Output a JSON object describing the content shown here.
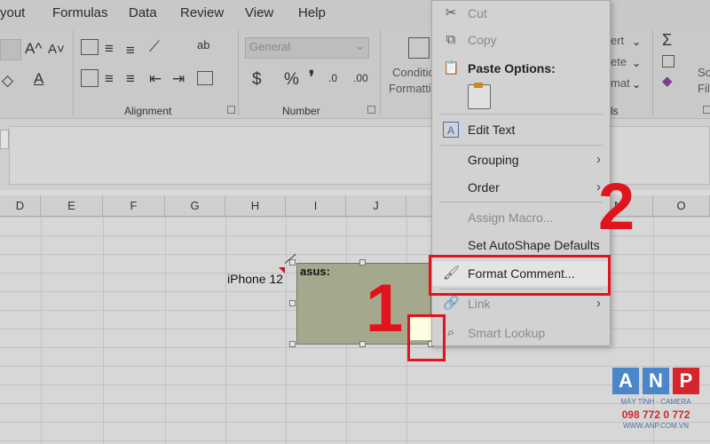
{
  "menubar": {
    "tabs": [
      "yout",
      "Formulas",
      "Data",
      "Review",
      "View",
      "Help"
    ]
  },
  "ribbon": {
    "font_size_glyphs": [
      "A^",
      "A˅"
    ],
    "groups": {
      "alignment": "Alignment",
      "number": "Number"
    },
    "number_format": "General",
    "currency": "$",
    "percent": "%",
    "comma": "❜",
    "conditional": [
      "Conditio",
      "Formatti"
    ],
    "partial_right": [
      "ert",
      "ete",
      "mat"
    ],
    "partial_label": "ls",
    "sigma": "Σ",
    "sort_labels": [
      "So",
      "Filt"
    ]
  },
  "columns": [
    "D",
    "E",
    "F",
    "G",
    "H",
    "I",
    "J",
    "N",
    "O"
  ],
  "cell": {
    "text": "iPhone 12"
  },
  "comment": {
    "author": "asus:"
  },
  "context_menu": {
    "items": [
      {
        "label": "Cut",
        "icon": "cut-icon",
        "glyph": "✂",
        "disabled": true
      },
      {
        "label": "Copy",
        "icon": "copy-icon",
        "glyph": "⧉",
        "disabled": true
      },
      {
        "label": "Paste Options:",
        "icon": "paste-icon",
        "glyph": "📋",
        "disabled": false
      },
      {
        "label": "Edit Text",
        "icon": "edit-text-icon",
        "glyph": "A",
        "disabled": false
      },
      {
        "label": "Grouping",
        "icon": "",
        "glyph": "",
        "disabled": false,
        "submenu": true
      },
      {
        "label": "Order",
        "icon": "",
        "glyph": "",
        "disabled": false,
        "submenu": true
      },
      {
        "label": "Assign Macro...",
        "icon": "",
        "glyph": "",
        "disabled": true
      },
      {
        "label": "Set AutoShape Defaults",
        "icon": "",
        "glyph": "",
        "disabled": false
      },
      {
        "label": "Format Comment...",
        "icon": "format-comment-icon",
        "glyph": "🖌",
        "disabled": false
      },
      {
        "label": "Link",
        "icon": "link-icon",
        "glyph": "🔗",
        "disabled": true,
        "submenu": true
      },
      {
        "label": "Smart Lookup",
        "icon": "smart-lookup-icon",
        "glyph": "⌕",
        "disabled": true
      }
    ],
    "submenu_arrow": "›"
  },
  "annotations": {
    "step1": "1",
    "step2": "2"
  },
  "watermark": {
    "letters": [
      "A",
      "N",
      "P"
    ],
    "tagline": "MÁY TÍNH - CAMERA",
    "phone": "098 772 0 772",
    "website": "WWW.ANP.COM.VN"
  },
  "colors": {
    "accent_red": "#e0141c",
    "logo_blue": "#4a86c8",
    "logo_red": "#d4262c"
  }
}
